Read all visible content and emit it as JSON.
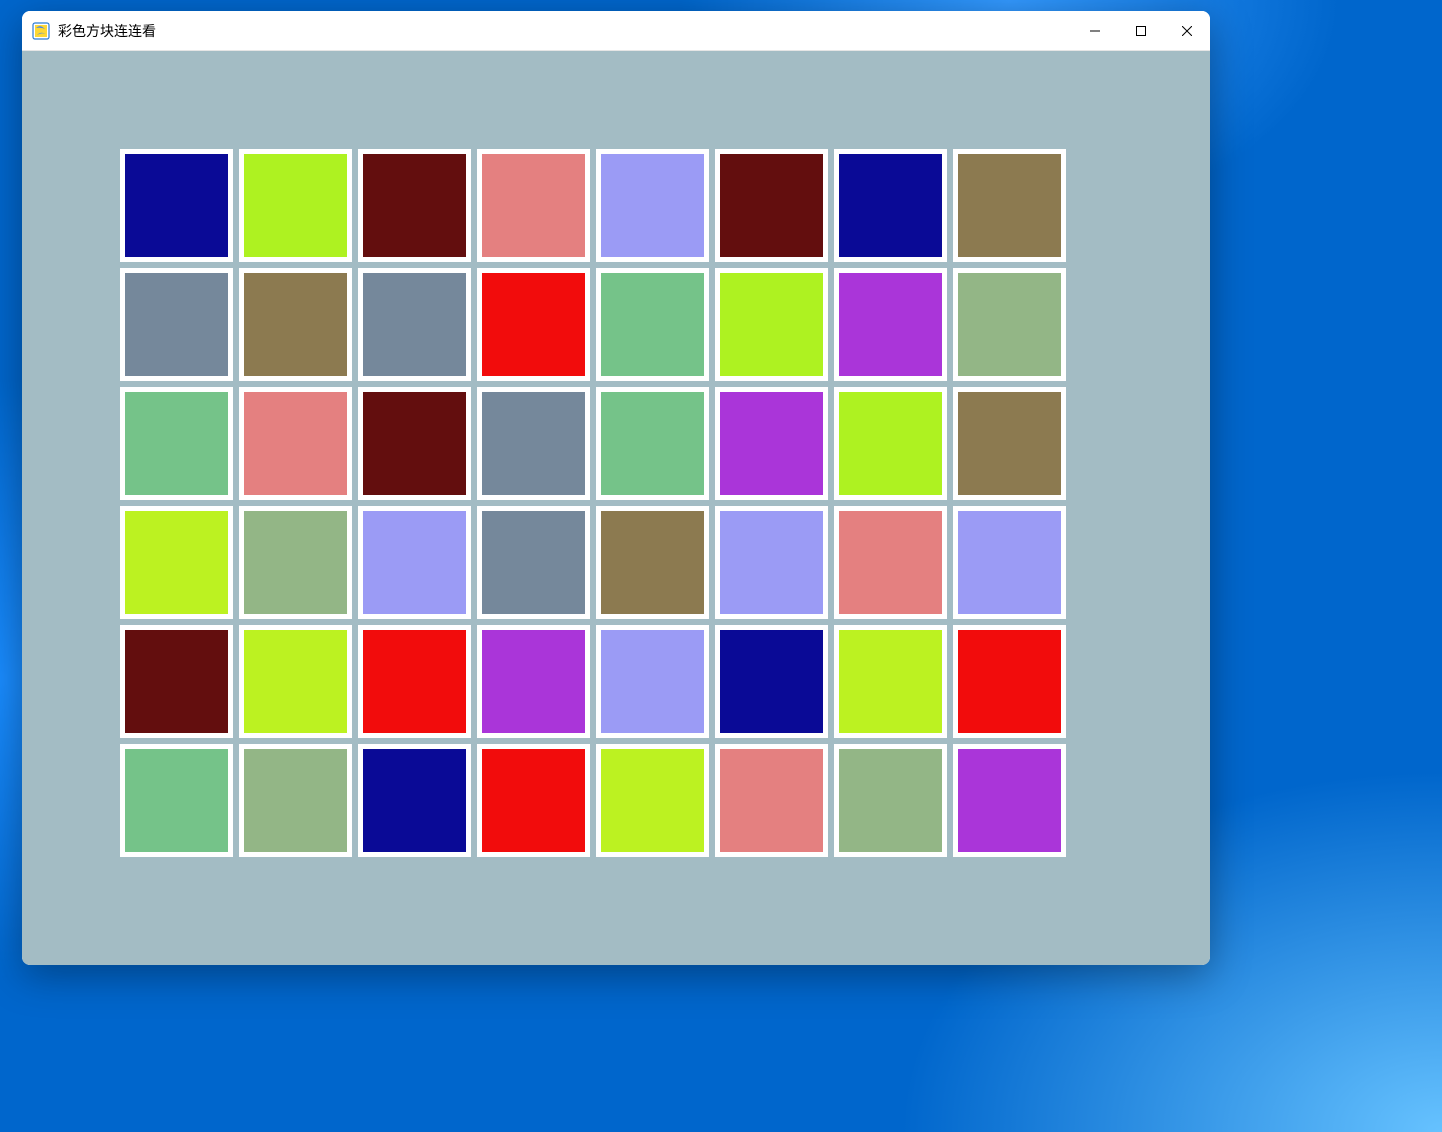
{
  "window": {
    "title": "彩色方块连连看"
  },
  "colors": {
    "navy": "#0a0a96",
    "lime": "#aef221",
    "maroon": "#630e0e",
    "pink": "#e48080",
    "periwinkle": "#9b9bf5",
    "olive": "#8c7a50",
    "slate": "#75889b",
    "red": "#f20c0c",
    "mint": "#75c389",
    "purple": "#aa35d9",
    "sage": "#93b686",
    "limeBright": "#bcf221"
  },
  "grid": {
    "rows": 6,
    "cols": 8,
    "tiles": [
      [
        "navy",
        "lime",
        "maroon",
        "pink",
        "periwinkle",
        "maroon",
        "navy",
        "olive"
      ],
      [
        "slate",
        "olive",
        "slate",
        "red",
        "mint",
        "lime",
        "purple",
        "sage"
      ],
      [
        "mint",
        "pink",
        "maroon",
        "slate",
        "mint",
        "purple",
        "lime",
        "olive"
      ],
      [
        "limeBright",
        "sage",
        "periwinkle",
        "slate",
        "olive",
        "periwinkle",
        "pink",
        "periwinkle"
      ],
      [
        "maroon",
        "limeBright",
        "red",
        "purple",
        "periwinkle",
        "navy",
        "limeBright",
        "red"
      ],
      [
        "mint",
        "sage",
        "navy",
        "red",
        "limeBright",
        "pink",
        "sage",
        "purple"
      ]
    ]
  }
}
